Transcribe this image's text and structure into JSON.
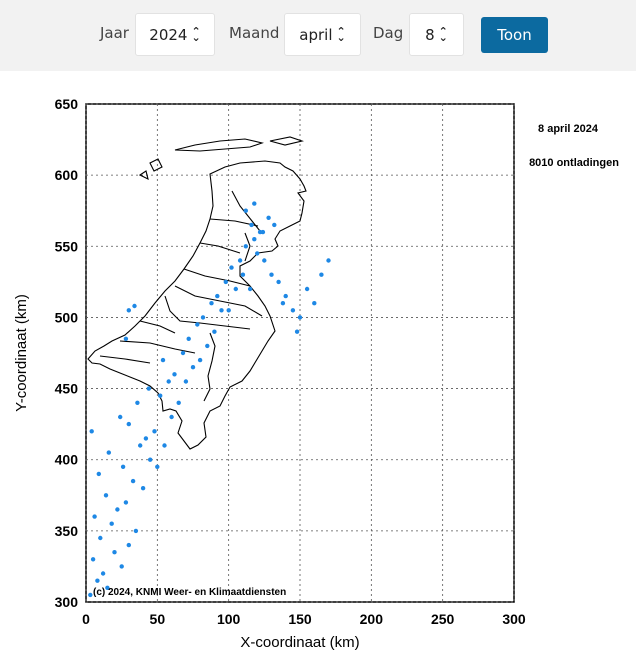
{
  "controls": {
    "year_label": "Jaar",
    "year_value": "2024",
    "month_label": "Maand",
    "month_value": "april",
    "day_label": "Dag",
    "day_value": "8",
    "submit_label": "Toon"
  },
  "colors": {
    "toolbar_bg": "#f2f2f2",
    "button": "#0c6aa0",
    "points": "#1e88e5"
  },
  "chart_data": {
    "type": "scatter",
    "date_text": "8 april 2024",
    "count_text": "8010 ontladingen",
    "credit": "(c) 2024, KNMI Weer- en Klimaatdiensten",
    "xlabel": "X-coordinaat (km)",
    "ylabel": "Y-coordinaat (km)",
    "xlim": [
      0,
      300
    ],
    "ylim": [
      300,
      650
    ],
    "xticks": [
      "0",
      "50",
      "100",
      "150",
      "200",
      "250",
      "300"
    ],
    "yticks": [
      "300",
      "350",
      "400",
      "450",
      "500",
      "550",
      "600",
      "650"
    ],
    "grid": true,
    "series": [
      {
        "color": "#1e88e5",
        "x": [
          3,
          8,
          12,
          5,
          15,
          20,
          10,
          25,
          30,
          18,
          6,
          22,
          35,
          28,
          14,
          40,
          9,
          33,
          26,
          45,
          16,
          38,
          50,
          42,
          4,
          30,
          55,
          24,
          48,
          36,
          60,
          52,
          44,
          65,
          58,
          70,
          62,
          54,
          75,
          68,
          80,
          72,
          85,
          78,
          90,
          82,
          95,
          88,
          100,
          92,
          105,
          98,
          110,
          102,
          115,
          108,
          120,
          112,
          125,
          118,
          130,
          122,
          135,
          128,
          140,
          132,
          145,
          138,
          150,
          155,
          160,
          148,
          165,
          170,
          112,
          118,
          116,
          124,
          30,
          34,
          28
        ],
        "y": [
          305,
          315,
          320,
          330,
          310,
          335,
          345,
          325,
          340,
          355,
          360,
          365,
          350,
          370,
          375,
          380,
          390,
          385,
          395,
          400,
          405,
          410,
          395,
          415,
          420,
          425,
          410,
          430,
          420,
          440,
          430,
          445,
          450,
          440,
          455,
          455,
          460,
          470,
          465,
          475,
          470,
          485,
          480,
          495,
          490,
          500,
          505,
          510,
          505,
          515,
          520,
          525,
          530,
          535,
          520,
          540,
          545,
          550,
          540,
          555,
          530,
          560,
          525,
          570,
          515,
          565,
          505,
          510,
          500,
          520,
          510,
          490,
          530,
          540,
          575,
          580,
          565,
          560,
          505,
          508,
          485
        ]
      }
    ]
  }
}
